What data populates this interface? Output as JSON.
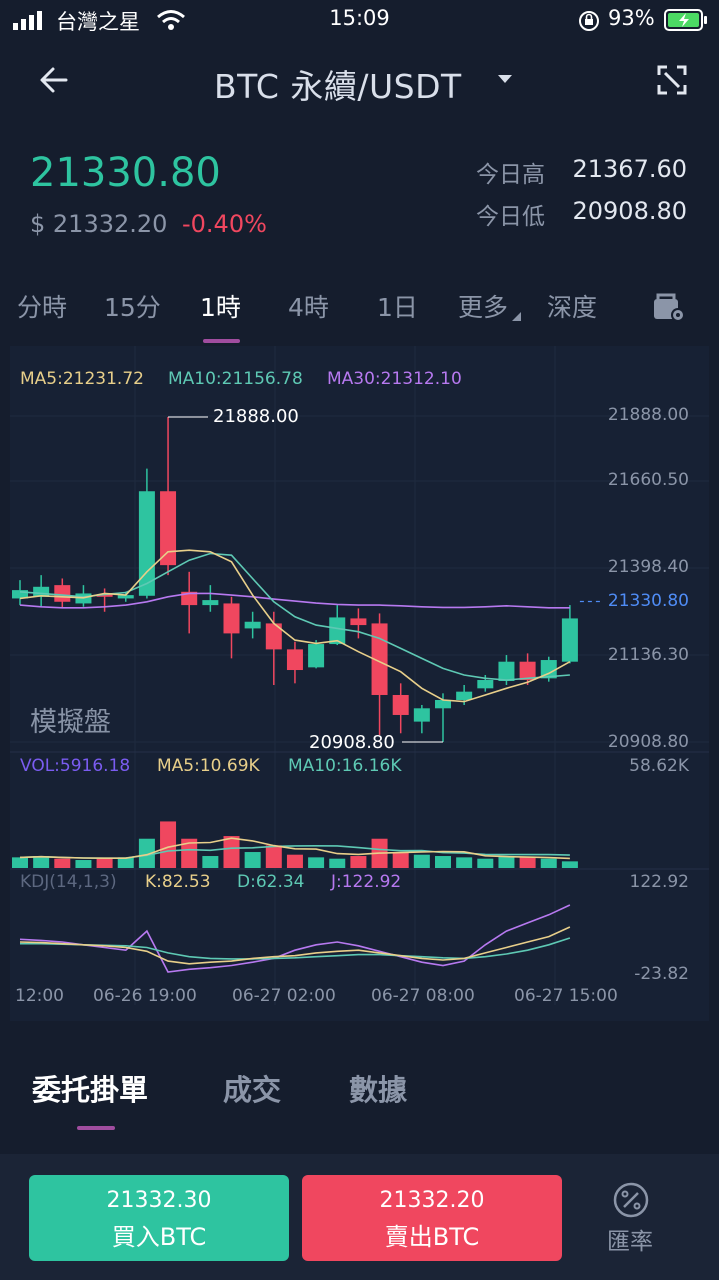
{
  "status_bar": {
    "carrier": "台灣之星",
    "time": "15:09",
    "battery": "93%"
  },
  "header": {
    "title": "BTC 永續/USDT"
  },
  "price": {
    "last": "21330.80",
    "usd": "$ 21332.20",
    "change": "-0.40%",
    "high_label": "今日高",
    "high": "21367.60",
    "low_label": "今日低",
    "low": "20908.80"
  },
  "timeframes": {
    "t0": "分時",
    "t1": "15分",
    "t2": "1時",
    "t3": "4時",
    "t4": "1日",
    "t5": "更多",
    "t6": "深度"
  },
  "chart": {
    "legend_main": {
      "ma5": "MA5:21231.72",
      "ma10": "MA10:21156.78",
      "ma30": "MA30:21312.10"
    },
    "price_axis": {
      "p1": "21888.00",
      "p2": "21660.50",
      "p3": "21398.40",
      "p4": "21330.80",
      "p5": "21136.30",
      "p6": "20908.80"
    },
    "max_marker": "21888.00",
    "min_marker": "20908.80",
    "watermark": "模擬盤",
    "legend_vol": {
      "vol": "VOL:5916.18",
      "ma5": "MA5:10.69K",
      "ma10": "MA10:16.16K"
    },
    "vol_axis_max": "58.62K",
    "legend_kdj": {
      "kdj": "KDJ(14,1,3)",
      "k": "K:82.53",
      "d": "D:62.34",
      "j": "J:122.92"
    },
    "kdj_axis": {
      "max": "122.92",
      "min": "-23.82"
    },
    "time_axis": {
      "t0": "12:00",
      "t1": "06-26 19:00",
      "t2": "06-27 02:00",
      "t3": "06-27 08:00",
      "t4": "06-27 15:00"
    }
  },
  "chart_data": {
    "type": "candlestick",
    "title": "",
    "interval": "1時",
    "ylim": [
      20908.8,
      21888.0
    ],
    "colors": {
      "up": "#2ec4a0",
      "down": "#f0475f",
      "ma5": "#e8cf8a",
      "ma10": "#5ec9b4",
      "ma30": "#b779f0"
    },
    "candles": [
      {
        "o": 21340,
        "h": 21395,
        "l": 21320,
        "c": 21365
      },
      {
        "o": 21345,
        "h": 21410,
        "l": 21315,
        "c": 21375
      },
      {
        "o": 21380,
        "h": 21400,
        "l": 21310,
        "c": 21330
      },
      {
        "o": 21325,
        "h": 21380,
        "l": 21315,
        "c": 21355
      },
      {
        "o": 21352,
        "h": 21370,
        "l": 21300,
        "c": 21345
      },
      {
        "o": 21340,
        "h": 21360,
        "l": 21330,
        "c": 21350
      },
      {
        "o": 21348,
        "h": 21730,
        "l": 21340,
        "c": 21662
      },
      {
        "o": 21662,
        "h": 21885,
        "l": 21410,
        "c": 21440
      },
      {
        "o": 21360,
        "h": 21420,
        "l": 21235,
        "c": 21320
      },
      {
        "o": 21320,
        "h": 21380,
        "l": 21300,
        "c": 21335
      },
      {
        "o": 21325,
        "h": 21345,
        "l": 21160,
        "c": 21235
      },
      {
        "o": 21250,
        "h": 21300,
        "l": 21220,
        "c": 21270
      },
      {
        "o": 21265,
        "h": 21300,
        "l": 21080,
        "c": 21187
      },
      {
        "o": 21187,
        "h": 21210,
        "l": 21085,
        "c": 21125
      },
      {
        "o": 21133,
        "h": 21215,
        "l": 21130,
        "c": 21203
      },
      {
        "o": 21203,
        "h": 21320,
        "l": 21200,
        "c": 21283
      },
      {
        "o": 21280,
        "h": 21310,
        "l": 21220,
        "c": 21260
      },
      {
        "o": 21265,
        "h": 21295,
        "l": 20930,
        "c": 21050
      },
      {
        "o": 21050,
        "h": 21085,
        "l": 20935,
        "c": 20990
      },
      {
        "o": 20970,
        "h": 21020,
        "l": 20935,
        "c": 21010
      },
      {
        "o": 21010,
        "h": 21055,
        "l": 20908.8,
        "c": 21035
      },
      {
        "o": 21035,
        "h": 21080,
        "l": 21020,
        "c": 21060
      },
      {
        "o": 21070,
        "h": 21110,
        "l": 21060,
        "c": 21095
      },
      {
        "o": 21092,
        "h": 21170,
        "l": 21080,
        "c": 21150
      },
      {
        "o": 21150,
        "h": 21175,
        "l": 21080,
        "c": 21095
      },
      {
        "o": 21100,
        "h": 21165,
        "l": 21090,
        "c": 21155
      },
      {
        "o": 21150,
        "h": 21320,
        "l": 21145,
        "c": 21280
      }
    ],
    "ma5": [
      21340,
      21348,
      21345,
      21342,
      21355,
      21350,
      21420,
      21480,
      21485,
      21480,
      21450,
      21350,
      21265,
      21215,
      21205,
      21213,
      21180,
      21150,
      21120,
      21070,
      21035,
      21030,
      21050,
      21070,
      21088,
      21115,
      21150
    ],
    "ma10": [
      21360,
      21355,
      21350,
      21345,
      21352,
      21358,
      21385,
      21420,
      21455,
      21475,
      21470,
      21400,
      21330,
      21285,
      21260,
      21250,
      21240,
      21220,
      21190,
      21160,
      21130,
      21110,
      21100,
      21095,
      21100,
      21105,
      21110
    ],
    "ma30": [
      21320,
      21315,
      21312,
      21312,
      21315,
      21320,
      21330,
      21345,
      21355,
      21355,
      21350,
      21345,
      21338,
      21332,
      21326,
      21322,
      21320,
      21320,
      21318,
      21315,
      21313,
      21313,
      21315,
      21318,
      21315,
      21312,
      21312
    ],
    "volume": {
      "ylim": [
        0,
        58.62
      ],
      "values": [
        8,
        9,
        7,
        6,
        7,
        8,
        22,
        35,
        22,
        9,
        24,
        12,
        17,
        10,
        8,
        7,
        9,
        22,
        12,
        10,
        9,
        8,
        7,
        9,
        8,
        7,
        5
      ]
    },
    "kdj": {
      "ylim": [
        -23.82,
        122.92
      ],
      "k": [
        55,
        54,
        52,
        50,
        48,
        45,
        38,
        20,
        15,
        18,
        20,
        25,
        28,
        30,
        35,
        38,
        40,
        35,
        30,
        25,
        22,
        25,
        35,
        45,
        55,
        65,
        82.53
      ],
      "d": [
        52,
        52,
        51,
        50,
        49,
        48,
        45,
        35,
        28,
        25,
        24,
        24,
        25,
        26,
        28,
        30,
        32,
        32,
        30,
        28,
        26,
        25,
        28,
        33,
        40,
        50,
        62.34
      ],
      "j": [
        60,
        58,
        55,
        50,
        45,
        40,
        75,
        0,
        5,
        8,
        12,
        18,
        25,
        40,
        50,
        55,
        48,
        38,
        28,
        18,
        12,
        20,
        50,
        75,
        90,
        105,
        122.92
      ]
    }
  },
  "lower": {
    "tabs": {
      "orders": "委托掛單",
      "trades": "成交",
      "data": "數據"
    },
    "buy": {
      "price": "21332.30",
      "label": "買入BTC"
    },
    "sell": {
      "price": "21332.20",
      "label": "賣出BTC"
    },
    "fx": "匯率"
  }
}
